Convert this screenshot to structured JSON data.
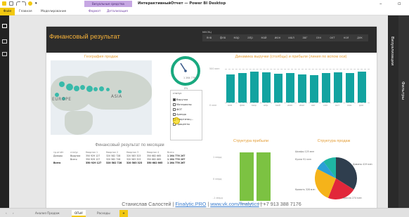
{
  "window": {
    "title": "ИнтерактивныйОтчет — Power BI Desktop",
    "contextual_group": "Визуальные средства",
    "minimize": "–",
    "maximize": "▫"
  },
  "ribbon": {
    "file": "Файл",
    "tabs": [
      "Главная",
      "Моделирование",
      "Формат",
      "Детализация"
    ]
  },
  "report": {
    "title": "Финансовый результат",
    "month_slicer": {
      "label": "месяц",
      "months": [
        "янв",
        "фев",
        "мар",
        "апр",
        "май",
        "июн",
        "июл",
        "авг",
        "сен",
        "окт",
        "ноя",
        "дек"
      ]
    },
    "map": {
      "title": "География продаж",
      "labels": [
        "EUROPE",
        "ASIA"
      ]
    },
    "gauge": {
      "value": "1 264 776",
      "min": "0%"
    },
    "status_slicer": {
      "header": "статус",
      "items": [
        {
          "label": "Выручка",
          "checked": true
        },
        {
          "label": "Материалы",
          "checked": false
        },
        {
          "label": "ФОТ",
          "checked": false
        },
        {
          "label": "Аренда",
          "checked": false
        },
        {
          "label": "Амортизац...",
          "checked": false
        },
        {
          "label": "Проценты",
          "checked": false
        }
      ]
    },
    "combo_chart": {
      "title": "Динамика выручки (столбцы) и прибыли (линия по вспом оси)",
      "y_ticks": [
        "500 млн",
        "0 млн"
      ]
    },
    "table": {
      "title": "Финансовый результат по месяцам",
      "columns": [
        "тр.отчёт",
        "статус",
        "Квартал 1",
        "Квартал 2",
        "Квартал 3",
        "Квартал 4",
        "Всего"
      ],
      "rows": [
        [
          "Доходы",
          "Выручка",
          "350 929 127",
          "320 582 728",
          "320 583 323",
          "350 682 665",
          "1 264 776 267"
        ],
        [
          "",
          "Всего",
          "350 929 127",
          "320 582 728",
          "320 583 323",
          "350 682 665",
          "1 264 776 267"
        ],
        [
          "Всего",
          "",
          "350 929 127",
          "320 582 728",
          "320 583 323",
          "350 682 665",
          "1 264 776 267"
        ]
      ]
    },
    "profit_structure": {
      "title": "Структура прибыли",
      "y_ticks": [
        "1 млрд",
        "0 млрд",
        "-1 млрд"
      ],
      "categories": [
        "Выручка",
        "Всего"
      ]
    },
    "sales_structure": {
      "title": "Структура продаж",
      "labels": [
        "Шкафы 125 млн",
        "Кухни 91 млн",
        "Диваны 419 млн",
        "Кровать 328 млн",
        "Кресла 274 млн"
      ]
    },
    "footer": {
      "author": "Станислав Салостей",
      "sep": "|",
      "link1": "Finalytic.PRO",
      "link2": "www.vk.com/finalytics",
      "phone": "+7 913 388 7176"
    }
  },
  "panes": {
    "visualizations": "Визуализации",
    "filters": "Фильтры"
  },
  "pages": {
    "tabs": [
      "Анализ Продаж",
      "ОПиУ",
      "Расходы"
    ],
    "active": "ОПиУ",
    "add": "+"
  },
  "colors": {
    "accent_yellow": "#f2c811",
    "teal": "#12a3a0",
    "green": "#7cc242",
    "orange_title": "#e39c34",
    "pie": [
      "#2f3e4e",
      "#e2273a",
      "#f5b31a",
      "#2b9fd6",
      "#1fb5a3"
    ]
  },
  "chart_data": [
    {
      "type": "bar",
      "title": "Динамика выручки (столбцы) и прибыли (линия по вспом оси)",
      "categories": [
        "янв",
        "фев",
        "мар",
        "апр",
        "май",
        "июн",
        "июл",
        "авг",
        "сен",
        "окт",
        "ноя",
        "дек"
      ],
      "values": [
        108,
        112,
        118,
        116,
        110,
        112,
        108,
        106,
        114,
        116,
        112,
        118
      ],
      "ylabel": "",
      "ylim": [
        0,
        140
      ]
    },
    {
      "type": "bar",
      "title": "Структура прибыли",
      "categories": [
        "Выручка",
        "Всего"
      ],
      "values": [
        1.26,
        1.26
      ],
      "ylim": [
        -1,
        1.5
      ]
    },
    {
      "type": "pie",
      "title": "Структура продаж",
      "categories": [
        "Диваны",
        "Кресла",
        "Кровать",
        "Кухни",
        "Шкафы"
      ],
      "values": [
        419,
        274,
        328,
        91,
        125
      ]
    }
  ]
}
